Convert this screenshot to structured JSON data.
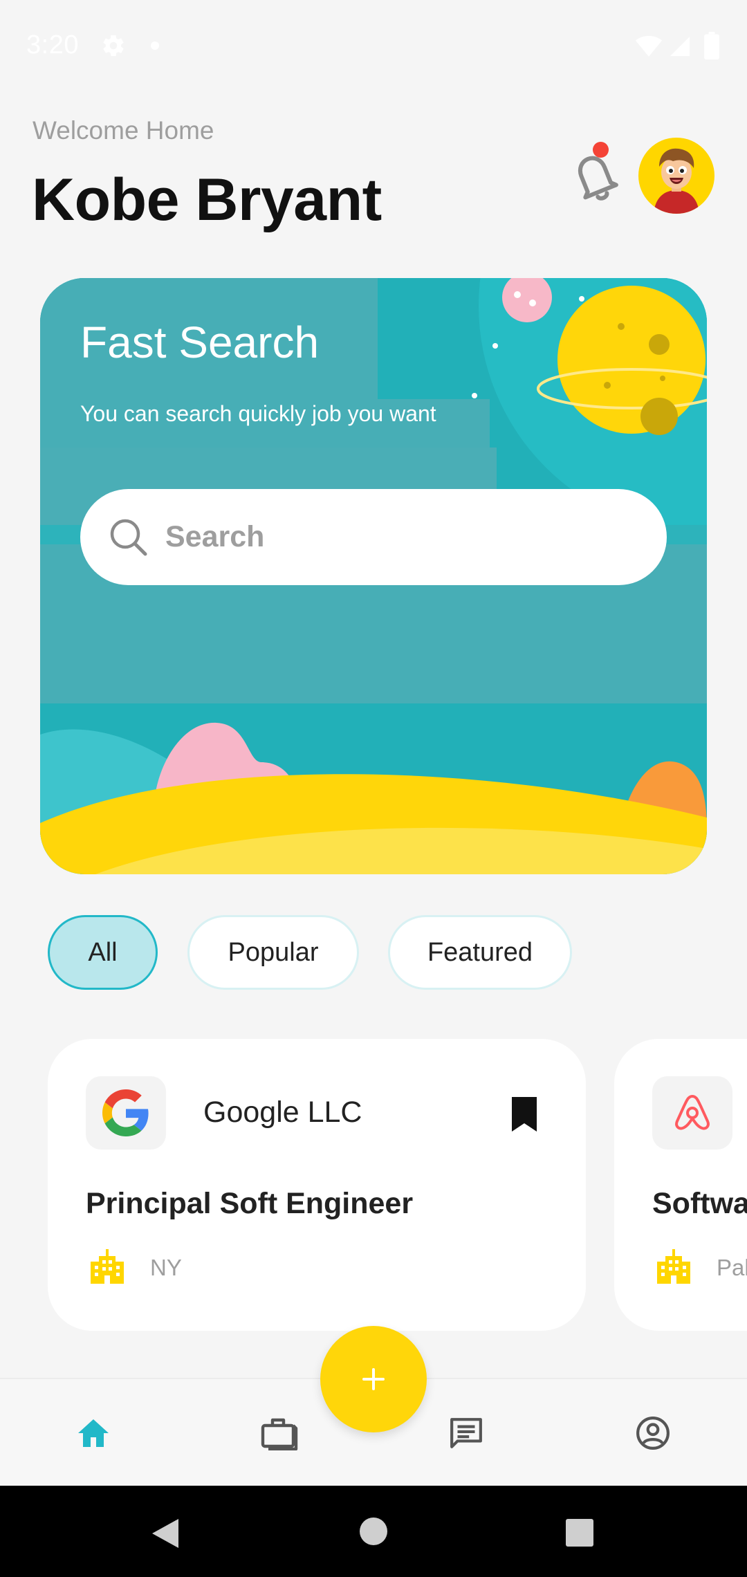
{
  "status_bar": {
    "time": "3:20",
    "icons": [
      "gear-icon",
      "notification-dot",
      "wifi-icon",
      "signal-icon",
      "battery-icon"
    ]
  },
  "header": {
    "welcome": "Welcome Home",
    "name": "Kobe Bryant",
    "icons": [
      "bell-icon",
      "avatar"
    ]
  },
  "banner": {
    "title": "Fast Search",
    "subtitle": "You can search quickly job you want",
    "search_placeholder": "Search",
    "search_value": ""
  },
  "filters": {
    "chips": [
      "All",
      "Popular",
      "Featured"
    ],
    "selected": "All"
  },
  "jobs": [
    {
      "company": "Google LLC",
      "title": "Principal Soft Engineer",
      "location": "NY",
      "logo_icon": "google-logo",
      "bookmarked": true
    },
    {
      "company": "",
      "title": "Softwa",
      "location": "Pal",
      "logo_icon": "airbnb-logo",
      "bookmarked": false
    }
  ],
  "bottom_nav": {
    "items": [
      "home-icon",
      "briefcase-icon",
      "message-icon",
      "profile-icon"
    ],
    "active": "home-icon",
    "fab_icon": "plus-icon"
  },
  "colors": {
    "accent": "#22B8C8",
    "banner": "#22B0B8",
    "fab": "#FFD60A",
    "badge": "#F44336",
    "building": "#FFD600",
    "airbnb": "#FF5A5F"
  }
}
